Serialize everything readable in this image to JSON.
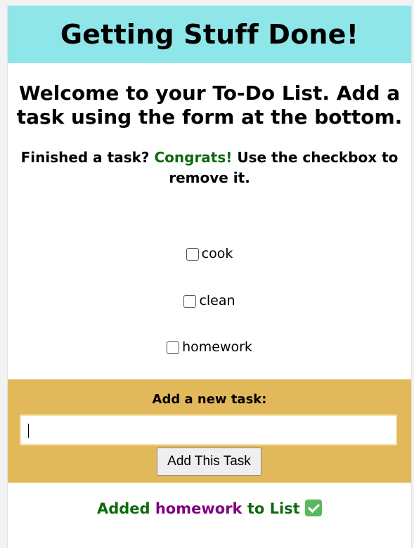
{
  "header": {
    "title": "Getting Stuff Done!"
  },
  "intro": {
    "welcome": "Welcome to your To-Do List. Add a task using the form at the bottom.",
    "hint_before": "Finished a task?",
    "hint_congrats": "Congrats!",
    "hint_after": "Use the checkbox to remove it."
  },
  "tasks": [
    {
      "label": "cook",
      "checked": false
    },
    {
      "label": "clean",
      "checked": false
    },
    {
      "label": "homework",
      "checked": false
    }
  ],
  "form": {
    "label": "Add a new task:",
    "input_value": "",
    "button_label": "Add This Task"
  },
  "status": {
    "prefix": "Added",
    "item": "homework",
    "suffix": "to List",
    "icon": "check-mark-icon"
  },
  "colors": {
    "header_bg": "#8fe6e9",
    "form_bg": "#e2b95a",
    "success_green": "#0c6a0c",
    "item_purple": "#800080"
  }
}
